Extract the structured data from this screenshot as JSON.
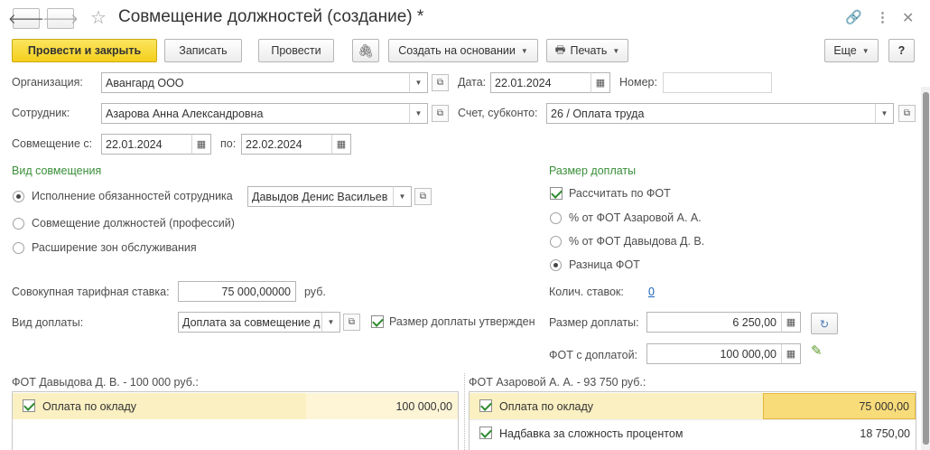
{
  "window": {
    "title": "Совмещение должностей (создание) *",
    "title_icons": [
      "link-icon",
      "more-icon",
      "close-icon"
    ]
  },
  "toolbar": {
    "post_close": "Провести и закрыть",
    "save": "Записать",
    "post": "Провести",
    "create_based": "Создать на основании",
    "print": "Печать",
    "more": "Еще",
    "help": "?"
  },
  "header": {
    "org_label": "Организация:",
    "org_value": "Авангард ООО",
    "date_label": "Дата:",
    "date_value": "22.01.2024",
    "number_label": "Номер:",
    "number_value": "",
    "employee_label": "Сотрудник:",
    "employee_value": "Азарова Анна Александровна",
    "account_label": "Счет, субконто:",
    "account_value": "26 / Оплата труда",
    "from_label": "Совмещение с:",
    "from_value": "22.01.2024",
    "to_label": "по:",
    "to_value": "22.02.2024"
  },
  "kind": {
    "heading": "Вид совмещения",
    "options": [
      {
        "label": "Исполнение обязанностей сотрудника",
        "selected": true
      },
      {
        "label": "Совмещение должностей (профессий)",
        "selected": false
      },
      {
        "label": "Расширение зон обслуживания",
        "selected": false
      }
    ],
    "employee_value": "Давыдов Денис Васильев"
  },
  "surcharge": {
    "heading": "Размер доплаты",
    "calc_label": "Рассчитать по ФОТ",
    "calc_checked": true,
    "options": [
      {
        "label": "% от ФОТ Азаровой А. А.",
        "selected": false
      },
      {
        "label": "% от ФОТ Давыдова Д. В.",
        "selected": false
      },
      {
        "label": "Разница ФОТ",
        "selected": true
      }
    ],
    "rates_label": "Колич. ставок:",
    "rates_value": "0",
    "amount_label": "Размер доплаты:",
    "amount_value": "6 250,00",
    "fot_label": "ФОТ с доплатой:",
    "fot_value": "100 000,00"
  },
  "tariff": {
    "label": "Совокупная тарифная ставка:",
    "value": "75 000,00000",
    "unit": "руб.",
    "type_label": "Вид доплаты:",
    "type_value": "Доплата за совмещение д",
    "approved_label": "Размер доплаты утвержден",
    "approved_checked": true
  },
  "fot_left": {
    "caption": "ФОТ Давыдова Д. В. - 100 000 руб.:",
    "rows": [
      {
        "name": "Оплата по окладу",
        "value": "100 000,00",
        "checked": true
      }
    ]
  },
  "fot_right": {
    "caption": "ФОТ Азаровой А. А. - 93 750 руб.:",
    "rows": [
      {
        "name": "Оплата по окладу",
        "value": "75 000,00",
        "checked": true
      },
      {
        "name": "Надбавка за сложность процентом",
        "value": "18 750,00",
        "checked": true
      }
    ]
  },
  "colors": {
    "primary": "#f5cf1c",
    "section_heading": "#3a8f3a",
    "link": "#1a63b8",
    "row_selected": "#fbf0c2"
  }
}
